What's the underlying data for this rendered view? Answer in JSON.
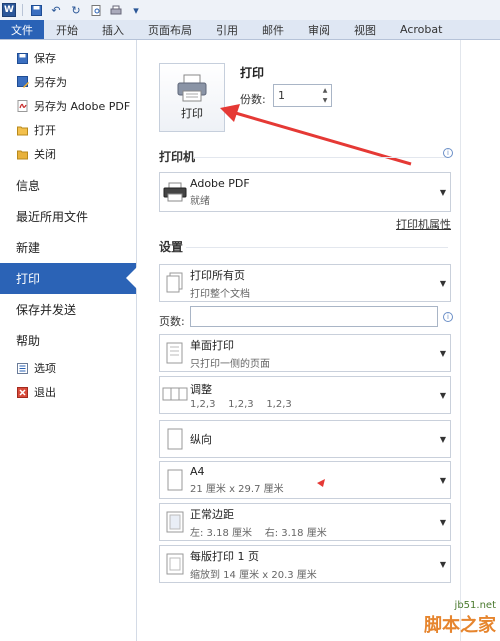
{
  "quick_access": {
    "logo": "W"
  },
  "tabs": [
    "文件",
    "开始",
    "插入",
    "页面布局",
    "引用",
    "邮件",
    "审阅",
    "视图",
    "Acrobat"
  ],
  "nav": {
    "save": "保存",
    "save_as": "另存为",
    "save_as_pdf": "另存为 Adobe PDF",
    "open": "打开",
    "close": "关闭",
    "info": "信息",
    "recent": "最近所用文件",
    "new": "新建",
    "print": "打印",
    "save_send": "保存并发送",
    "help": "帮助",
    "options": "选项",
    "exit": "退出"
  },
  "print": {
    "title": "打印",
    "button_label": "打印",
    "copies_label": "份数:",
    "copies_value": "1"
  },
  "printer": {
    "section_title": "打印机",
    "name": "Adobe PDF",
    "status": "就绪",
    "properties_link": "打印机属性"
  },
  "settings": {
    "section_title": "设置",
    "pages_label": "页数:",
    "items": [
      {
        "title": "打印所有页",
        "subtitle": "打印整个文档"
      },
      {
        "title": "单面打印",
        "subtitle": "只打印一侧的页面"
      },
      {
        "title": "调整",
        "subtitle": "1,2,3    1,2,3    1,2,3"
      },
      {
        "title": "纵向",
        "subtitle": ""
      },
      {
        "title": "A4",
        "subtitle": "21 厘米 x 29.7 厘米"
      },
      {
        "title": "正常边距",
        "subtitle": "左: 3.18 厘米    右: 3.18 厘米"
      },
      {
        "title": "每版打印 1 页",
        "subtitle": "缩放到 14 厘米 x 20.3 厘米"
      }
    ]
  },
  "watermark": {
    "domain": "jb51.net",
    "brand": "脚本之家"
  },
  "colors": {
    "accent": "#2b63b6",
    "arrow": "#e53935"
  }
}
